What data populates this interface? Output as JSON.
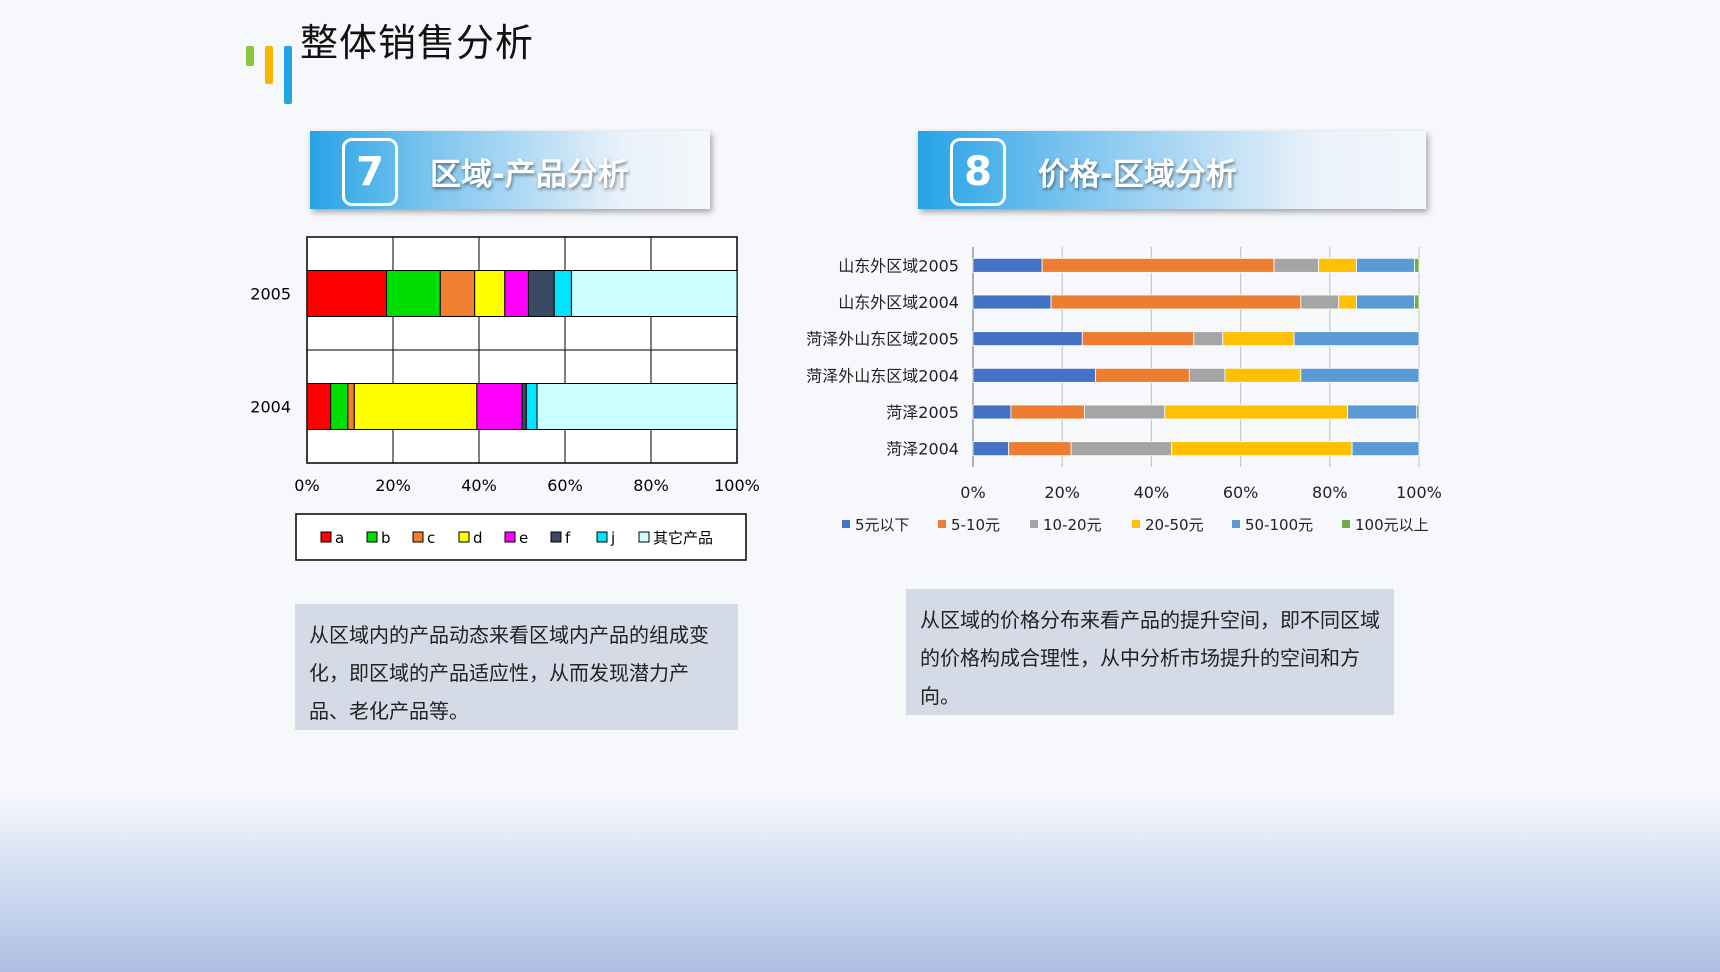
{
  "page": {
    "title": "整体销售分析"
  },
  "sections": [
    {
      "number": "7",
      "title": "区域-产品分析"
    },
    {
      "number": "8",
      "title": "价格-区域分析"
    }
  ],
  "descriptions": [
    "从区域内的产品动态来看区域内产品的组成变化，即区域的产品适应性，从而发现潜力产品、老化产品等。",
    "从区域的价格分布来看产品的提升空间，即不同区域的价格构成合理性，从中分析市场提升的空间和方向。"
  ],
  "chart_data": [
    {
      "type": "bar",
      "orientation": "horizontal",
      "stacked": "percent",
      "categories": [
        "2005",
        "2004"
      ],
      "series": [
        {
          "name": "a",
          "color": "#ff0000",
          "values": [
            18.5,
            5.5
          ]
        },
        {
          "name": "b",
          "color": "#00dd00",
          "values": [
            12.5,
            4.0
          ]
        },
        {
          "name": "c",
          "color": "#f08030",
          "values": [
            8.0,
            1.5
          ]
        },
        {
          "name": "d",
          "color": "#ffff00",
          "values": [
            7.0,
            28.5
          ]
        },
        {
          "name": "e",
          "color": "#ff00ff",
          "values": [
            5.5,
            10.5
          ]
        },
        {
          "name": "f",
          "color": "#3a4a60",
          "values": [
            6.0,
            1.0
          ]
        },
        {
          "name": "j",
          "color": "#00e5ff",
          "values": [
            4.0,
            2.5
          ]
        },
        {
          "name": "其它产品",
          "color": "#ccffff",
          "values": [
            38.5,
            46.5
          ]
        }
      ],
      "xticks": [
        "0%",
        "20%",
        "40%",
        "60%",
        "80%",
        "100%"
      ],
      "xlim": [
        0,
        100
      ],
      "grid": true,
      "legend": "bottom"
    },
    {
      "type": "bar",
      "orientation": "horizontal",
      "stacked": "percent",
      "categories": [
        "山东外区域2005",
        "山东外区域2004",
        "菏泽外山东区域2005",
        "菏泽外山东区域2004",
        "菏泽2005",
        "菏泽2004"
      ],
      "series": [
        {
          "name": "5元以下",
          "color": "#4472c4",
          "values": [
            15.5,
            17.5,
            24.5,
            27.5,
            8.5,
            8.0
          ]
        },
        {
          "name": "5-10元",
          "color": "#ed7d31",
          "values": [
            52.0,
            56.0,
            25.0,
            21.0,
            16.5,
            14.0
          ]
        },
        {
          "name": "10-20元",
          "color": "#a5a5a5",
          "values": [
            10.0,
            8.5,
            6.5,
            8.0,
            18.0,
            22.5
          ]
        },
        {
          "name": "20-50元",
          "color": "#ffc000",
          "values": [
            8.5,
            4.0,
            16.0,
            17.0,
            41.0,
            40.5
          ]
        },
        {
          "name": "50-100元",
          "color": "#5b9bd5",
          "values": [
            13.0,
            13.0,
            28.0,
            26.5,
            15.5,
            15.0
          ]
        },
        {
          "name": "100元以上",
          "color": "#70ad47",
          "values": [
            1.0,
            1.0,
            0,
            0,
            0.5,
            0
          ]
        }
      ],
      "xticks": [
        "0%",
        "20%",
        "40%",
        "60%",
        "80%",
        "100%"
      ],
      "xlim": [
        0,
        100
      ],
      "grid": "vertical",
      "legend": "bottom"
    }
  ]
}
